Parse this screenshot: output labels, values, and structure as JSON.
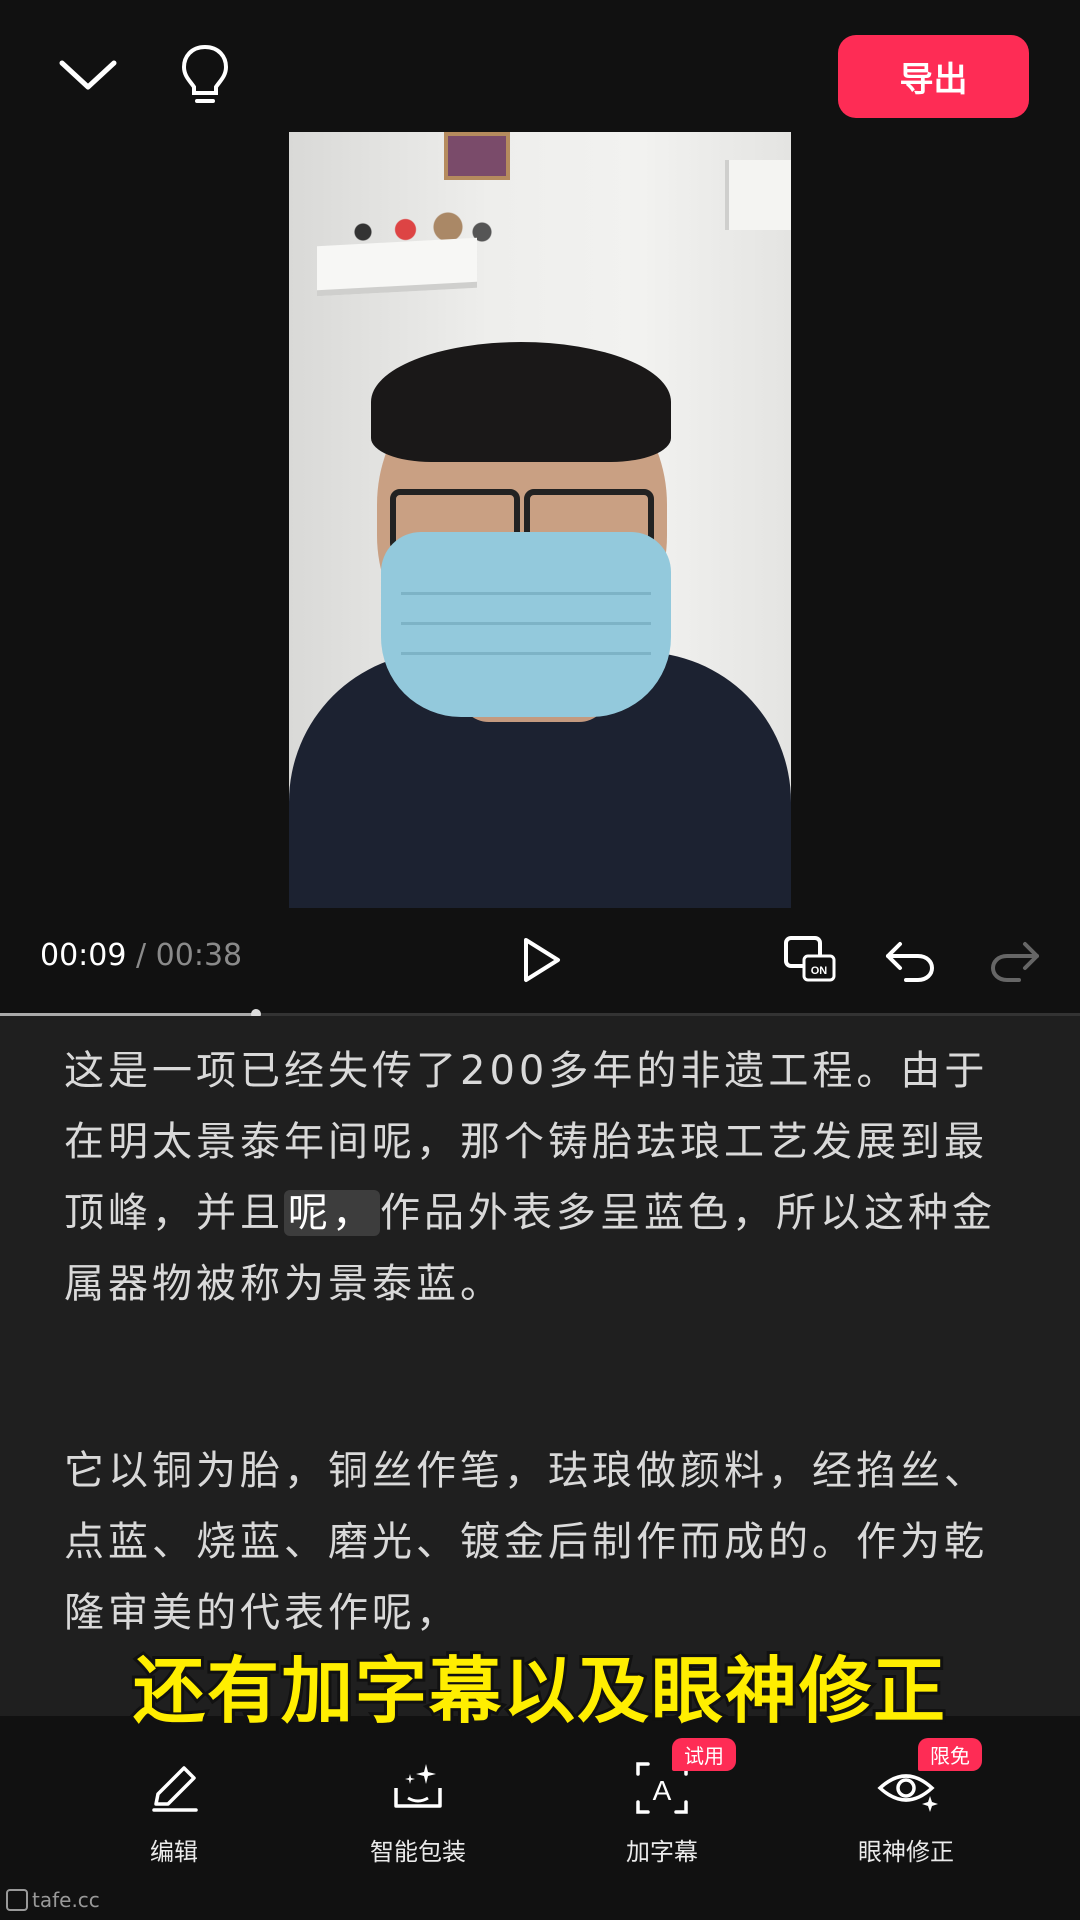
{
  "header": {
    "export_label": "导出"
  },
  "player": {
    "current_time": "00:09",
    "separator": "/",
    "total_time": "00:38",
    "progress": 0.237
  },
  "transcript": {
    "paragraph1_a": "这是一项已经失传了200多年的非遗工程。由于在明太景泰年间呢，那个铸胎珐琅工艺发展到最顶峰，并且",
    "paragraph1_highlight": "呢，",
    "paragraph1_b": "作品外表多呈蓝色，所以这种金属器物被称为景泰蓝。",
    "paragraph2": "它以铜为胎，铜丝作笔，珐琅做颜料，经掐丝、点蓝、烧蓝、磨光、镀金后制作而成的。作为乾隆审美的代表作呢，"
  },
  "caption_overlay": "还有加字幕以及眼神修正",
  "toolbar": {
    "items": [
      {
        "label": "编辑",
        "icon": "pencil-icon"
      },
      {
        "label": "智能包装",
        "icon": "magic-box-icon"
      },
      {
        "label": "加字幕",
        "icon": "text-caption-icon",
        "badge": "试用"
      },
      {
        "label": "眼神修正",
        "icon": "eye-sparkle-icon",
        "badge": "限免"
      }
    ]
  },
  "watermark": "tafe.cc",
  "colors": {
    "accent": "#fe2c55",
    "caption": "#ffee00",
    "background": "#111111"
  }
}
